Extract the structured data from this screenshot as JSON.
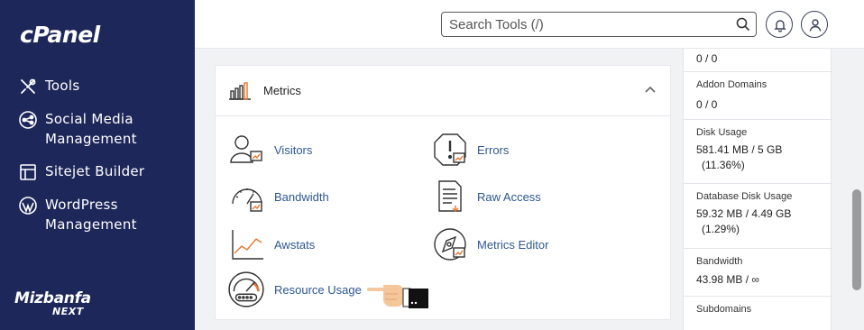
{
  "sidebar": {
    "logo": "cPanel",
    "items": [
      {
        "label": "Tools",
        "icon": "tools-icon"
      },
      {
        "label": "Social Media Management",
        "icon": "social-media-icon"
      },
      {
        "label": "Sitejet Builder",
        "icon": "sitejet-icon"
      },
      {
        "label": "WordPress Management",
        "icon": "wordpress-icon"
      }
    ],
    "brand_line1": "Mizbanfa",
    "brand_line2": "NEXT"
  },
  "topbar": {
    "search_placeholder": "Search Tools (/)",
    "notifications_icon": "bell-icon",
    "user_icon": "user-icon"
  },
  "metrics": {
    "title": "Metrics",
    "tools": [
      {
        "label": "Visitors",
        "icon": "visitors-icon"
      },
      {
        "label": "Errors",
        "icon": "errors-icon"
      },
      {
        "label": "Bandwidth",
        "icon": "bandwidth-icon"
      },
      {
        "label": "Raw Access",
        "icon": "raw-access-icon"
      },
      {
        "label": "Awstats",
        "icon": "awstats-icon"
      },
      {
        "label": "Metrics Editor",
        "icon": "metrics-editor-icon"
      },
      {
        "label": "Resource Usage",
        "icon": "resource-usage-icon"
      }
    ]
  },
  "stats": [
    {
      "label": "",
      "value": "0 / 0",
      "percent": ""
    },
    {
      "label": "Addon Domains",
      "value": "0 / 0",
      "percent": ""
    },
    {
      "label": "Disk Usage",
      "value": "581.41 MB / 5 GB",
      "percent": "(11.36%)"
    },
    {
      "label": "Database Disk Usage",
      "value": "59.32 MB / 4.49 GB",
      "percent": "(1.29%)"
    },
    {
      "label": "Bandwidth",
      "value": "43.98 MB / ∞",
      "percent": ""
    },
    {
      "label": "Subdomains",
      "value": "",
      "percent": ""
    }
  ],
  "colors": {
    "sidebar_bg": "#1e275a",
    "link": "#2c5792",
    "accent_orange": "#e8742b"
  }
}
